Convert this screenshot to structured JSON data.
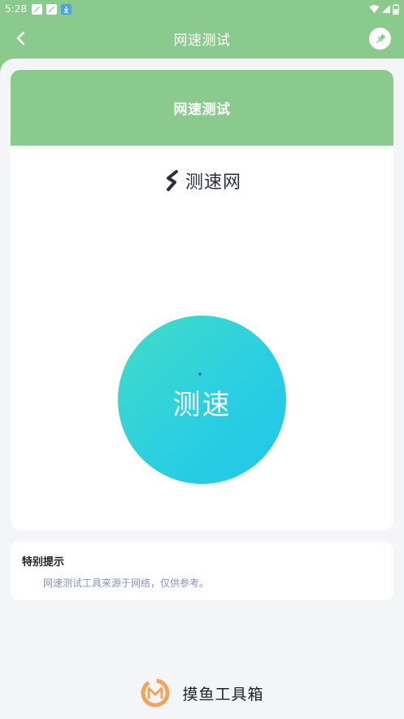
{
  "status_bar": {
    "time": "5:28",
    "notification_icons": [
      "edit-icon",
      "edit-icon",
      "download-icon"
    ],
    "right_icons": [
      "wifi-icon",
      "signal-icon",
      "battery-icon"
    ]
  },
  "app_bar": {
    "title": "网速测试",
    "back_icon": "back-arrow-icon",
    "pin_icon": "pin-icon"
  },
  "card": {
    "title": "网速测试",
    "brand_name": "测速网",
    "start_button_label": "测速"
  },
  "tip": {
    "title": "特别提示",
    "text": "网速测试工具来源于网络，仅供参考。"
  },
  "footer": {
    "app_name": "摸鱼工具箱",
    "logo_letter": "M"
  },
  "colors": {
    "theme_green": "#8bca8d",
    "circle_gradient_start": "#43dcc7",
    "circle_gradient_end": "#1fc6ea",
    "tip_text": "#8a93b3",
    "logo_orange": "#f0a45c"
  }
}
